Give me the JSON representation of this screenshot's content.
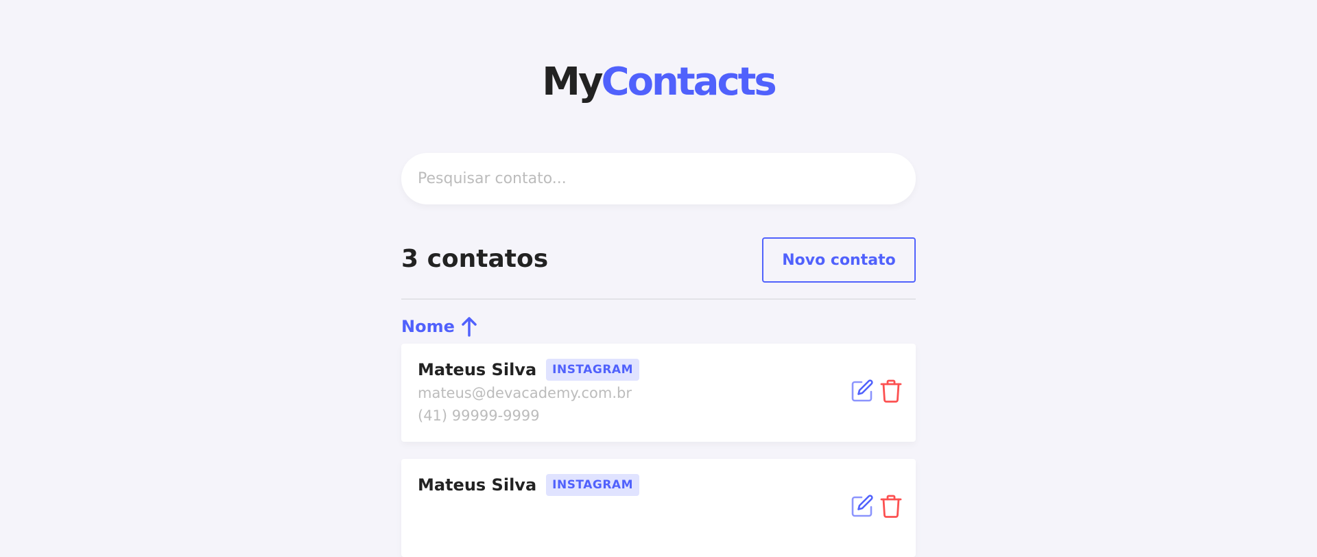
{
  "app": {
    "logo_part1": "My",
    "logo_part2": "Contacts"
  },
  "search": {
    "placeholder": "Pesquisar contato...",
    "value": ""
  },
  "list_header": {
    "count_text": "3 contatos",
    "new_button_label": "Novo contato"
  },
  "sort": {
    "label": "Nome",
    "direction": "ascending",
    "icon": "arrow-up-icon"
  },
  "contacts": [
    {
      "name": "Mateus Silva",
      "category": "INSTAGRAM",
      "email": "mateus@devacademy.com.br",
      "phone": "(41) 99999-9999"
    },
    {
      "name": "Mateus Silva",
      "category": "INSTAGRAM",
      "email": "",
      "phone": ""
    }
  ],
  "colors": {
    "primary": "#5061FC",
    "primary_light": "#E0E3FF",
    "danger": "#FC5050",
    "text": "#222222",
    "muted": "#BCBCBC",
    "background": "#F5F4FA"
  },
  "icons": {
    "edit": "edit-icon",
    "delete": "trash-icon"
  }
}
